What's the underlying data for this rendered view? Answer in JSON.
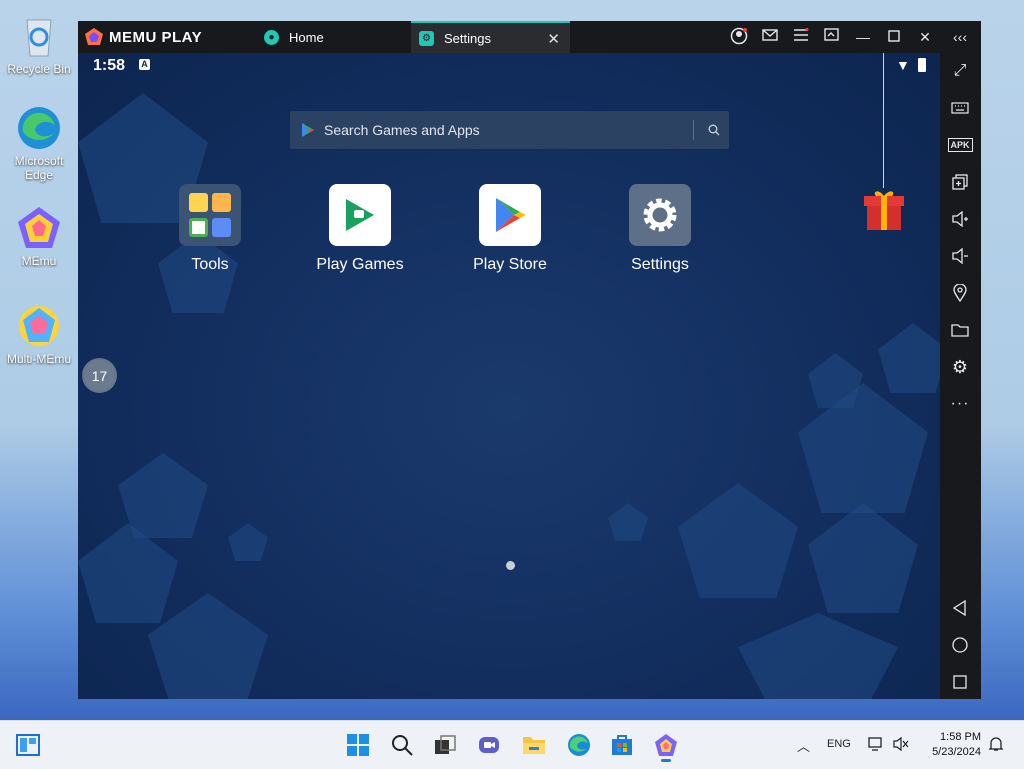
{
  "desktop": {
    "icons": [
      {
        "label": "Recycle Bin"
      },
      {
        "label": "Microsoft Edge"
      },
      {
        "label": "MEmu"
      },
      {
        "label": "Multi-MEmu"
      }
    ],
    "side_badge": "17"
  },
  "emulator": {
    "brand": "MEMU PLAY",
    "tabs": [
      {
        "label": "Home",
        "active": false
      },
      {
        "label": "Settings",
        "active": true
      }
    ],
    "status_time": "1:58",
    "search_placeholder": "Search Games and Apps",
    "apps": [
      {
        "label": "Tools"
      },
      {
        "label": "Play Games"
      },
      {
        "label": "Play Store"
      },
      {
        "label": "Settings"
      }
    ],
    "right_toolbar": [
      "fullscreen-icon",
      "keyboard-icon",
      "apk-icon",
      "multi-window-icon",
      "volume-up-icon",
      "volume-down-icon",
      "location-icon",
      "folder-icon",
      "gear-icon",
      "more-icon",
      "back-icon",
      "home-circle-icon",
      "recent-apps-icon"
    ],
    "colors": {
      "accent": "#1fc8b2",
      "titlebar": "#18191c",
      "screen_bg": "#133061"
    }
  },
  "taskbar": {
    "language": "ENG",
    "time": "1:58 PM",
    "date": "5/23/2024"
  }
}
